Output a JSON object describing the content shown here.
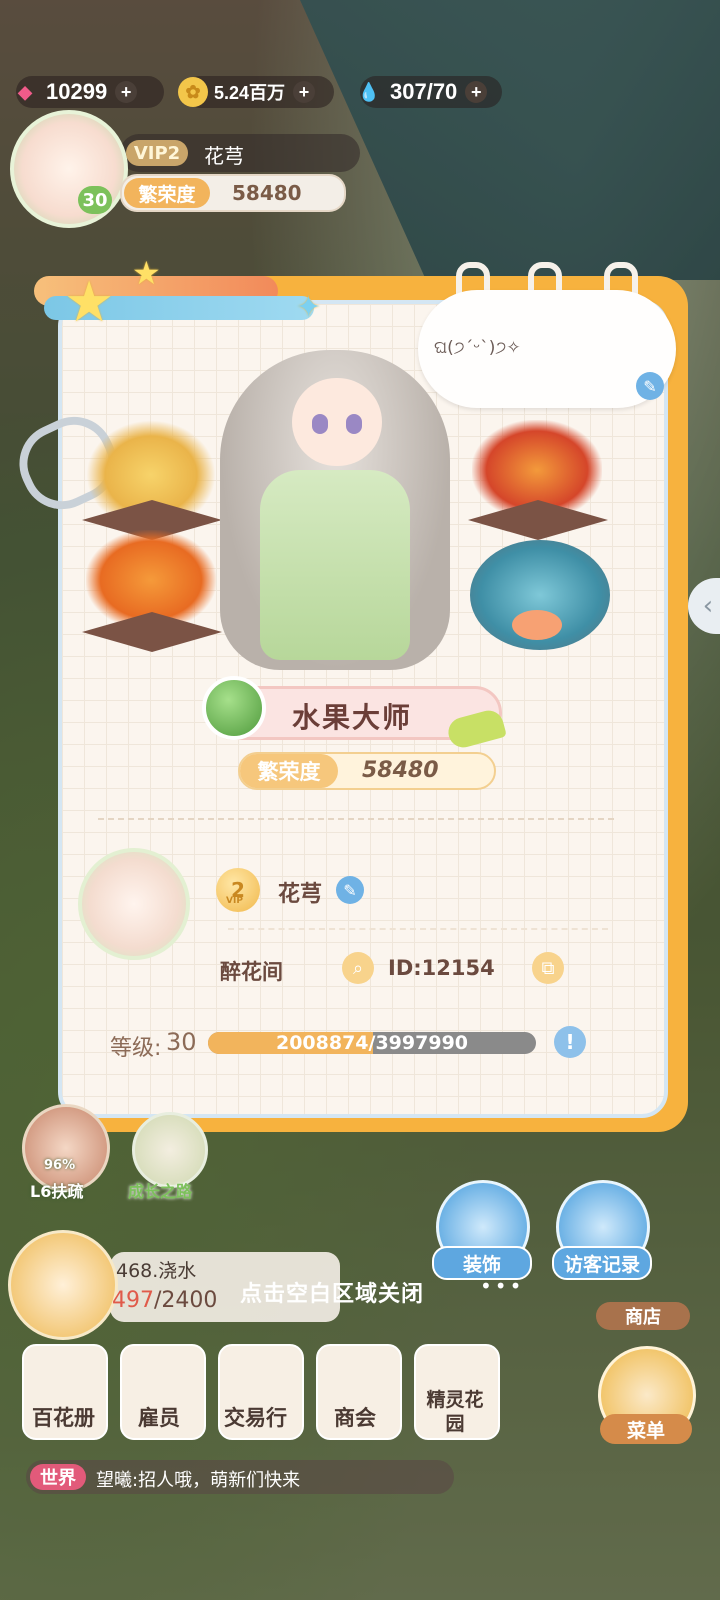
{
  "resources": [
    {
      "icon": "gem-icon",
      "value": "10299"
    },
    {
      "icon": "gold-coin-icon",
      "value": "5.24百万"
    },
    {
      "icon": "water-drop-icon",
      "value": "307/70"
    }
  ],
  "header": {
    "level": "30",
    "vip": "VIP2",
    "name": "花芎",
    "prosperity_label": "繁荣度",
    "prosperity_value": "58480"
  },
  "card": {
    "bubble_text": "ଘ(੭ˊᵕˋ)੭✧",
    "title": "水果大师",
    "prosperity_label": "繁荣度",
    "prosperity_value": "58480",
    "player_name": "花芎",
    "vip_level": "2",
    "vip_text": "VIP",
    "garden_name": "醉花间",
    "player_id": "ID:12154",
    "level_label": "等级:",
    "level_value": "30",
    "xp_text": "2008874/3997990",
    "xp_current": 2008874,
    "xp_total": 3997990
  },
  "hud": {
    "left_btn_percent": "96%",
    "left_btn_label": "L6扶疏",
    "growth_label": "成长之路",
    "decorate_label": "装饰",
    "visitors_label": "访客记录",
    "shop_label": "商店",
    "task_title": "468.浇水",
    "task_current": "497",
    "task_total": "/2400",
    "close_hint": "点击空白区域关闭",
    "dots": "•••",
    "menu_label": "菜单"
  },
  "nav": [
    {
      "label": "百花册",
      "name": "nav-flower-book"
    },
    {
      "label": "雇员",
      "name": "nav-employees"
    },
    {
      "label": "交易行",
      "name": "nav-trading"
    },
    {
      "label": "商会",
      "name": "nav-guild"
    },
    {
      "label": "精灵花园",
      "name": "nav-spirit-garden"
    }
  ],
  "chat": {
    "channel": "世界",
    "message": "望曦:招人哦，萌新们快来"
  },
  "colors": {
    "accent": "#f2b45c",
    "card_border": "#f7b23e",
    "blue": "#6fb2e5"
  }
}
